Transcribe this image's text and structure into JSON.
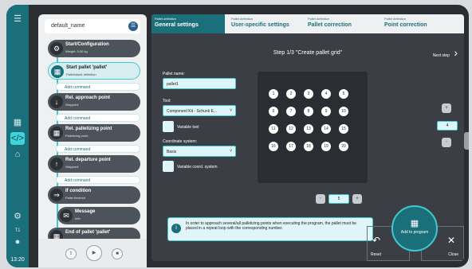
{
  "rail": {
    "time": "13:20",
    "icons": [
      "menu-icon",
      "grid-icon",
      "code-icon",
      "home-icon",
      "gear-icon",
      "info-icon",
      "person-icon"
    ],
    "t1": "T1"
  },
  "program": {
    "name": "default_name",
    "commands": [
      {
        "label": "Start/Configuration",
        "sub": "Weight: 0,00 kg",
        "icon": "gear-icon"
      },
      {
        "label": "Start pallet 'pallet'",
        "sub": "Pallet/stack definition",
        "icon": "grid-icon"
      },
      {
        "label": "Rel. approach point",
        "sub": "Waypoint",
        "icon": "arrow-down-icon"
      },
      {
        "label": "Rel. palletizing point",
        "sub": "Palletizing point -",
        "icon": "grid-icon"
      },
      {
        "label": "Rel. departure point",
        "sub": "Waypoint",
        "icon": "arrow-up-icon"
      },
      {
        "label": "If condition",
        "sub": "Pallet finished",
        "icon": "if-icon"
      },
      {
        "label": "Message",
        "sub": "Info",
        "icon": "message-icon"
      },
      {
        "label": "End of pallet 'pallet'",
        "sub": "",
        "icon": "grid-icon"
      }
    ],
    "add_command": "Add command"
  },
  "tabs": [
    {
      "small": "Pallet definition",
      "label": "General settings"
    },
    {
      "small": "Pallet definition",
      "label": "User-specific settings"
    },
    {
      "small": "Pallet definition",
      "label": "Pallet correction"
    },
    {
      "small": "Pallet definition",
      "label": "Point correction"
    }
  ],
  "step": {
    "title": "Step 1/3  \"Create pallet grid\"",
    "next": "Next step"
  },
  "form": {
    "pallet_name_label": "Pallet name:",
    "pallet_name_value": "pallet1",
    "tool_label": "Tool:",
    "tool_value": "Component Kit - Schunk E...",
    "variable_tool": "Variable tool",
    "coord_label": "Coordinate system:",
    "coord_value": "Basis",
    "variable_coord": "Variable coord. system"
  },
  "grid_points": [
    "1",
    "2",
    "3",
    "4",
    "5",
    "6",
    "7",
    "8",
    "9",
    "10",
    "11",
    "12",
    "13",
    "14",
    "15",
    "16",
    "17",
    "18",
    "19",
    "20"
  ],
  "rows_stepper": {
    "minus": "-",
    "value": "5",
    "plus": "+"
  },
  "cols_stepper": {
    "minus": "-",
    "value": "4",
    "plus": "+"
  },
  "info": "In order to approach several/all palletizing points when executing the program, the pallet must be placed in a repeat loop with the corresponding number.",
  "actions": {
    "add": "Add to program",
    "reset": "Reset",
    "close": "Close"
  },
  "colors": {
    "accent": "#1b6f7a",
    "highlight": "#3fc9d1",
    "panel": "#3b3f45"
  }
}
